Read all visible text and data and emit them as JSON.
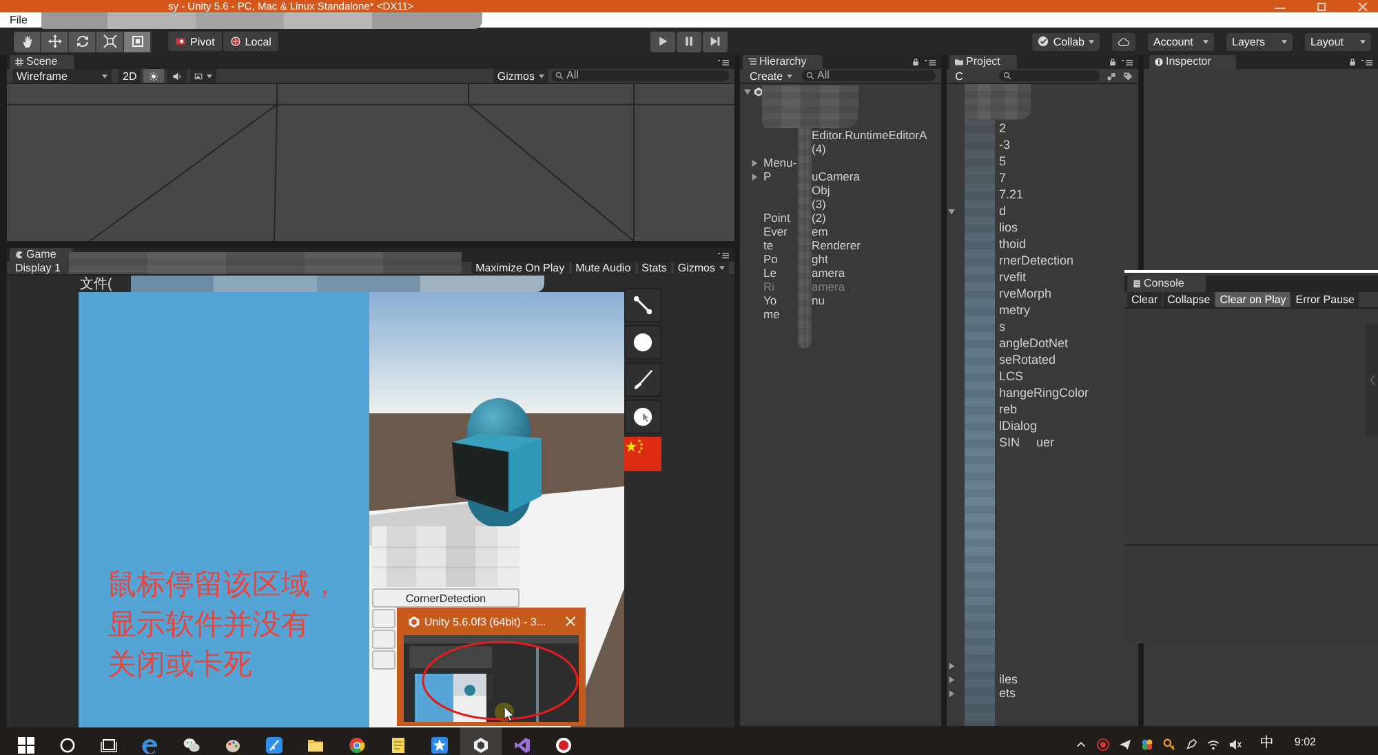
{
  "window": {
    "title": "sy - Unity 5.6 - PC, Mac & Linux Standalone* <DX11>"
  },
  "menu": [
    "File"
  ],
  "toolbar": {
    "tools": [
      {
        "kind": "hand",
        "selected": false
      },
      {
        "kind": "move",
        "selected": false
      },
      {
        "kind": "rotate",
        "selected": false
      },
      {
        "kind": "scale",
        "selected": false
      },
      {
        "kind": "rect",
        "selected": true
      }
    ],
    "pivot": "Pivot",
    "local": "Local",
    "collab": "Collab",
    "menus": [
      "Account",
      "Layers",
      "Layout"
    ]
  },
  "scene": {
    "tab": "Scene",
    "shading": "Wireframe",
    "mode": "2D",
    "toggles": [
      {
        "kind": "lighting",
        "on": true
      },
      {
        "kind": "audio",
        "on": false
      },
      {
        "kind": "effects",
        "on": false
      }
    ],
    "gizmos": "Gizmos",
    "search_placeholder": "All"
  },
  "game": {
    "tab": "Game",
    "display": "Display 1",
    "options": [
      "Maximize On Play",
      "Mute Audio",
      "Stats"
    ],
    "gizmos": "Gizmos",
    "app_menu": "文件(",
    "list_buttons": [
      "CornerDetection"
    ],
    "annotation": [
      "鼠标停留该区域，",
      "显示软件并没有",
      "关闭或卡死"
    ]
  },
  "hierarchy": {
    "tab": "Hierarchy",
    "create": "Create",
    "search_placeholder": "All",
    "root": {
      "kind": "open"
    },
    "rows": [
      {
        "kind": "item",
        "right": "Editor.RuntimeEditorA",
        "active": true
      },
      {
        "kind": "item",
        "right": "(4)",
        "active": true
      },
      {
        "kind": "parent",
        "left": "Menu-",
        "active": true
      },
      {
        "kind": "parent",
        "left": "P",
        "right": "uCamera",
        "active": true
      },
      {
        "kind": "item",
        "right": "Obj",
        "active": true
      },
      {
        "kind": "item",
        "right": "(3)",
        "active": true
      },
      {
        "kind": "item",
        "left": "Point",
        "right": "(2)",
        "active": true
      },
      {
        "kind": "item",
        "left": "Ever",
        "right": "em",
        "active": true
      },
      {
        "kind": "item",
        "left": "te",
        "right": "Renderer",
        "active": true
      },
      {
        "kind": "item",
        "left": "Po",
        "right": "ght",
        "active": true
      },
      {
        "kind": "item",
        "left": "Le",
        "right": "amera",
        "active": true
      },
      {
        "kind": "item",
        "left": "Ri",
        "right": "amera",
        "active": false
      },
      {
        "kind": "item",
        "left": "Yo",
        "right": "nu",
        "active": true
      },
      {
        "kind": "item",
        "left": "me",
        "active": true
      }
    ]
  },
  "project": {
    "tab": "Project",
    "create": "C",
    "rows": [
      {
        "kind": "item",
        "text": "2"
      },
      {
        "kind": "item",
        "text": "-3"
      },
      {
        "kind": "item",
        "text": "5"
      },
      {
        "kind": "item",
        "text": "7"
      },
      {
        "kind": "item",
        "text": "7.21"
      },
      {
        "kind": "open",
        "text": "d"
      },
      {
        "kind": "item",
        "text": "lios"
      },
      {
        "kind": "item",
        "text": "thoid"
      },
      {
        "kind": "item",
        "text": "rnerDetection"
      },
      {
        "kind": "item",
        "text": "rvefit"
      },
      {
        "kind": "item",
        "text": "rveMorph"
      },
      {
        "kind": "item",
        "text": "metry"
      },
      {
        "kind": "item",
        "text": "s"
      },
      {
        "kind": "item",
        "text": "angleDotNet"
      },
      {
        "kind": "item",
        "text": "seRotated"
      },
      {
        "kind": "item",
        "text": "LCS"
      },
      {
        "kind": "item",
        "text": "hangeRingColor"
      },
      {
        "kind": "item",
        "text": "reb"
      },
      {
        "kind": "item",
        "text": "lDialog"
      },
      {
        "kind": "item",
        "text": "SIN",
        "tail": "uer"
      }
    ],
    "bottom_rows": [
      {
        "kind": "parent"
      },
      {
        "kind": "parent",
        "text": "iles"
      },
      {
        "kind": "parent",
        "text": "ets"
      }
    ]
  },
  "inspector": {
    "tab": "Inspector"
  },
  "console": {
    "tab": "Console",
    "buttons": [
      {
        "label": "Clear",
        "on": false
      },
      {
        "label": "Collapse",
        "on": false
      },
      {
        "label": "Clear on Play",
        "on": true
      },
      {
        "label": "Error Pause",
        "on": false
      }
    ]
  },
  "preview": {
    "title": "Unity 5.6.0f3 (64bit) - 3..."
  },
  "taskbar": {
    "apps": [
      {
        "kind": "edge",
        "selected": false
      },
      {
        "kind": "wechat",
        "selected": false
      },
      {
        "kind": "paint",
        "selected": false
      },
      {
        "kind": "feather",
        "selected": false
      },
      {
        "kind": "folder",
        "selected": false
      },
      {
        "kind": "chrome",
        "selected": false
      },
      {
        "kind": "notes",
        "selected": false
      },
      {
        "kind": "star",
        "selected": false
      },
      {
        "kind": "unity",
        "selected": true
      },
      {
        "kind": "vs",
        "selected": false
      },
      {
        "kind": "record",
        "selected": false
      }
    ],
    "ime": "中",
    "clock": "9:02"
  }
}
